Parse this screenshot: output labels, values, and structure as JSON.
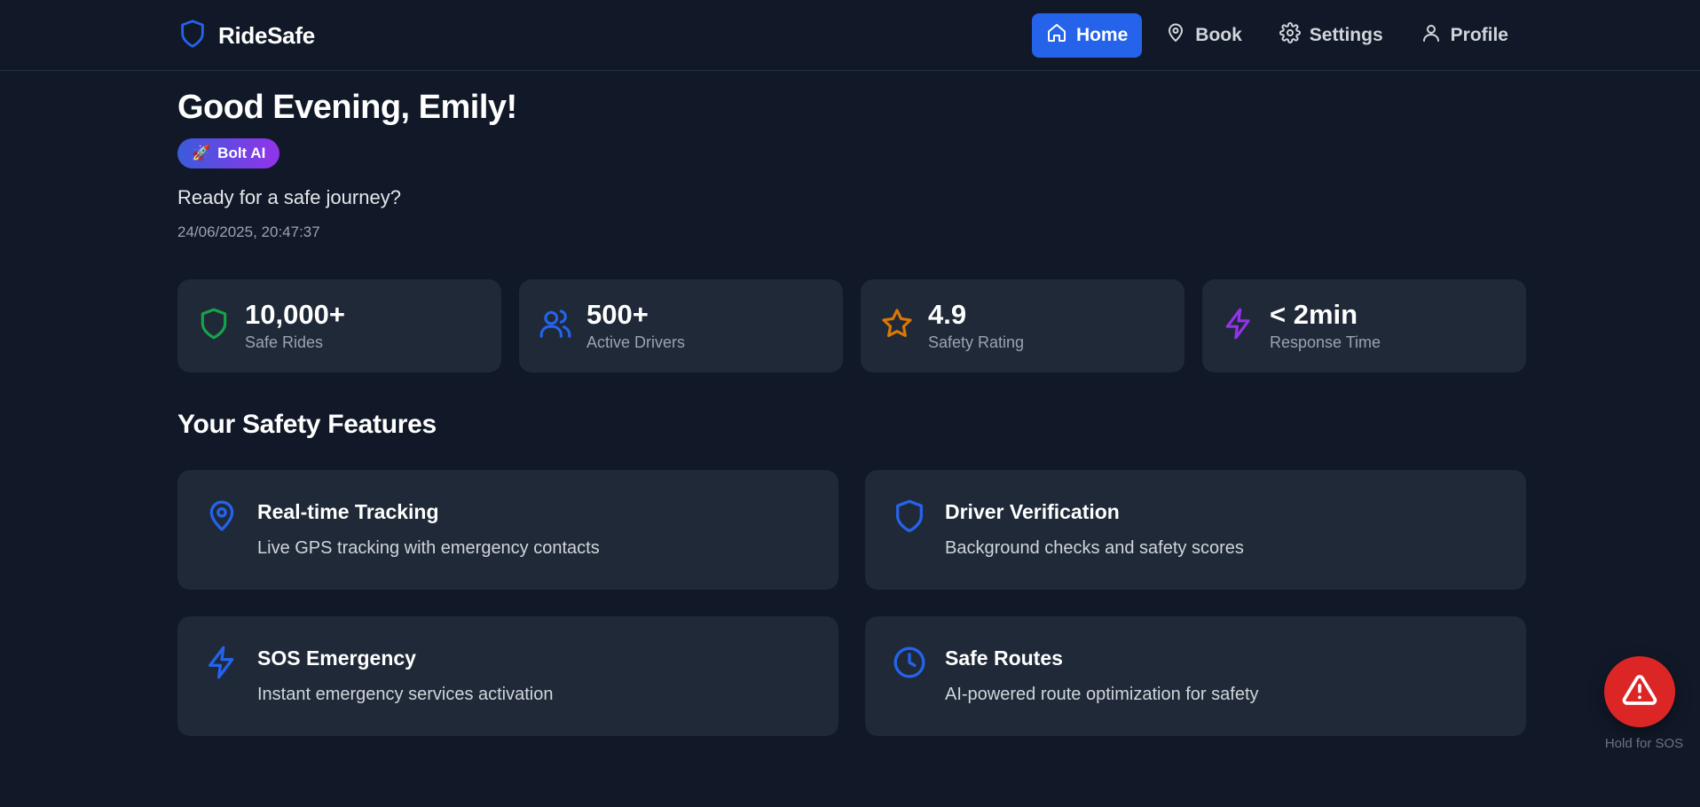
{
  "brand": {
    "name": "RideSafe",
    "icon": "shield-icon"
  },
  "nav": {
    "items": [
      {
        "label": "Home",
        "icon": "home-icon",
        "active": true
      },
      {
        "label": "Book",
        "icon": "map-pin-icon",
        "active": false
      },
      {
        "label": "Settings",
        "icon": "gear-icon",
        "active": false
      },
      {
        "label": "Profile",
        "icon": "user-icon",
        "active": false
      }
    ]
  },
  "hero": {
    "greeting": "Good Evening, Emily!",
    "badge": {
      "emoji": "🚀",
      "label": "Bolt AI"
    },
    "subtitle": "Ready for a safe journey?",
    "timestamp": "24/06/2025, 20:47:37"
  },
  "stats": [
    {
      "value": "10,000+",
      "label": "Safe Rides",
      "icon": "shield-icon",
      "color": "#16a34a"
    },
    {
      "value": "500+",
      "label": "Active Drivers",
      "icon": "users-icon",
      "color": "#2563eb"
    },
    {
      "value": "4.9",
      "label": "Safety Rating",
      "icon": "star-icon",
      "color": "#d97706"
    },
    {
      "value": "< 2min",
      "label": "Response Time",
      "icon": "lightning-icon",
      "color": "#9333ea"
    }
  ],
  "features": {
    "title": "Your Safety Features",
    "items": [
      {
        "title": "Real-time Tracking",
        "desc": "Live GPS tracking with emergency contacts",
        "icon": "map-pin-icon"
      },
      {
        "title": "Driver Verification",
        "desc": "Background checks and safety scores",
        "icon": "shield-icon"
      },
      {
        "title": "SOS Emergency",
        "desc": "Instant emergency services activation",
        "icon": "lightning-icon"
      },
      {
        "title": "Safe Routes",
        "desc": "AI-powered route optimization for safety",
        "icon": "clock-icon"
      }
    ]
  },
  "sos": {
    "hint": "Hold for SOS",
    "icon": "warning-icon",
    "color": "#dc2626"
  },
  "colors": {
    "accent": "#2563eb",
    "background": "#111827",
    "card": "#1f2937"
  }
}
